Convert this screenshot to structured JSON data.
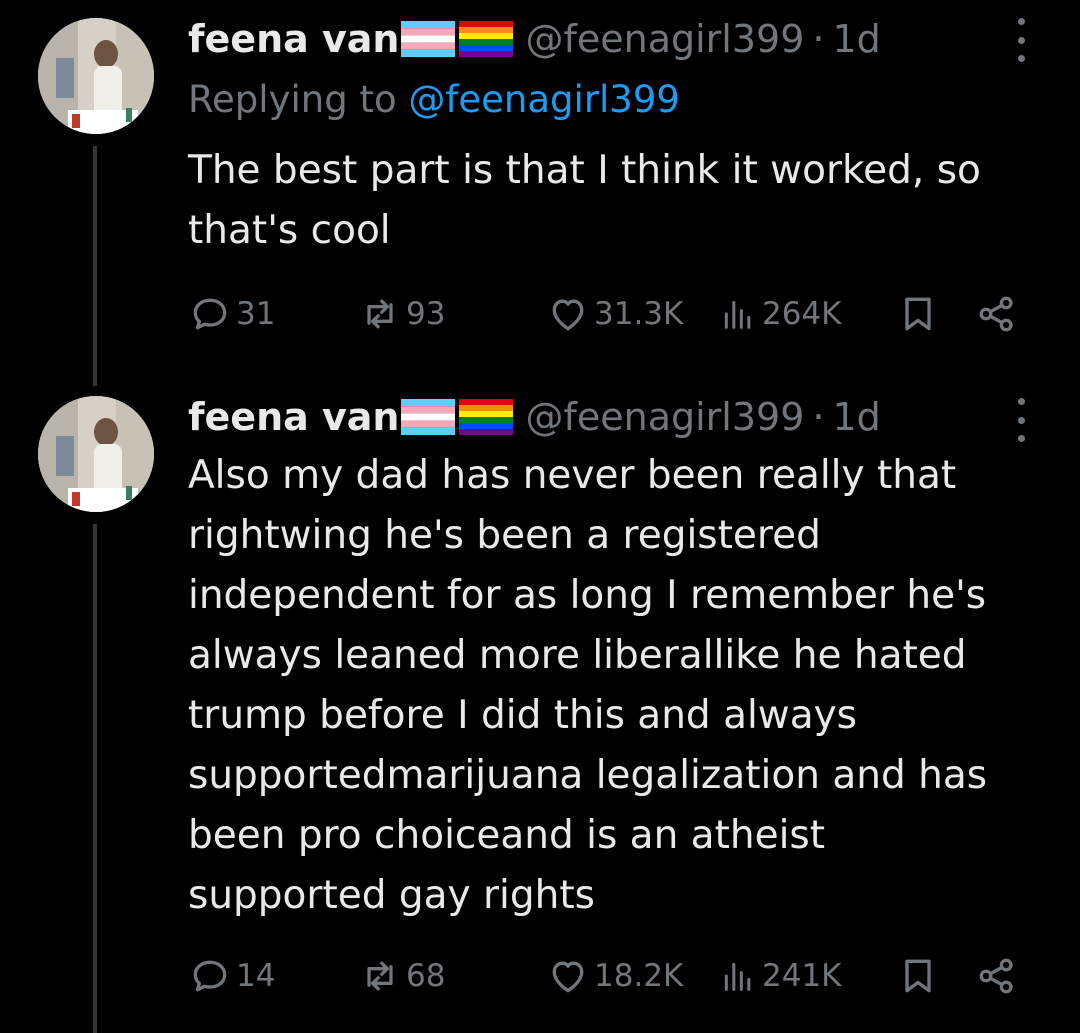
{
  "colors": {
    "background": "#000000",
    "text_primary": "#e7e9ea",
    "text_secondary": "#71767b",
    "link": "#1d9bf0",
    "thread_line": "#333639"
  },
  "tweets": [
    {
      "author_name": "feena van",
      "flags": [
        "transgender-flag-icon",
        "rainbow-flag-icon"
      ],
      "handle": "@feenagirl399",
      "separator": "·",
      "time": "1d",
      "replying_prefix": "Replying to",
      "replying_handle": "@feenagirl399",
      "text": "The best part is that I think it worked, so\nthat's cool",
      "stats": {
        "replies": "31",
        "reposts": "93",
        "likes": "31.3K",
        "views": "264K"
      }
    },
    {
      "author_name": "feena van",
      "flags": [
        "transgender-flag-icon",
        "rainbow-flag-icon"
      ],
      "handle": "@feenagirl399",
      "separator": "·",
      "time": "1d",
      "text": "Also my dad has never been really that\nrightwing he's been a registered\nindependent for as long I remember he's\nalways leaned more liberallike he hated\ntrump before I did this and always\nsupportedmarijuana legalization and has\nbeen pro choiceand is an atheist\nsupported gay rights",
      "stats": {
        "replies": "14",
        "reposts": "68",
        "likes": "18.2K",
        "views": "241K"
      }
    }
  ]
}
